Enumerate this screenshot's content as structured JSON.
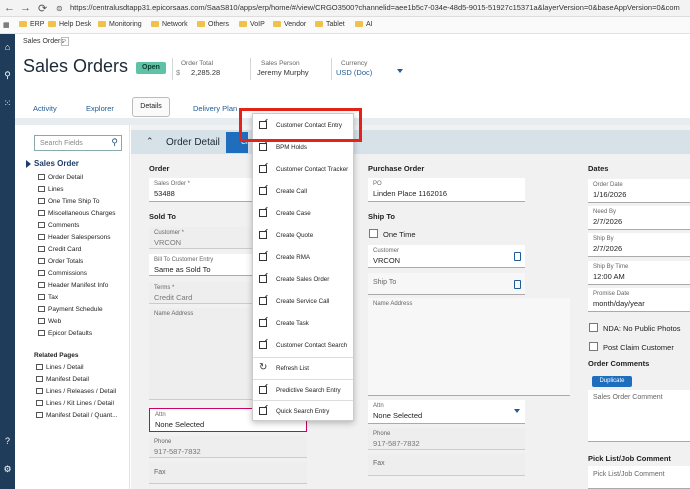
{
  "browser": {
    "url": "https://centralusdtapp31.epicorsaas.com/SaaS810/apps/erp/home/#/view/CRGO3500?channelid=aee1b5c7-034e-48d5-9015-51927c15371a&layerVersion=0&baseAppVersion=0&com",
    "bookmarks": [
      "ERP",
      "Help Desk",
      "Monitoring",
      "Network",
      "Others",
      "VoIP",
      "Vendor",
      "Tablet",
      "AI"
    ]
  },
  "header": {
    "breadcrumb": "Sales Orders",
    "title": "Sales Orders",
    "status": "Open",
    "order_total_label": "Order Total",
    "order_total_currency_symbol": "$",
    "order_total_value": "2,285.28",
    "sales_person_label": "Sales Person",
    "sales_person_value": "Jeremy Murphy",
    "currency_label": "Currency",
    "currency_value": "USD (Doc)"
  },
  "tabs": [
    "Activity",
    "Explorer",
    "Details",
    "Delivery Plan"
  ],
  "leftnav": {
    "search_placeholder": "Search Fields",
    "section": "Sales Order",
    "items": [
      "Order Detail",
      "Lines",
      "One Time Ship To",
      "Miscellaneous Charges",
      "Comments",
      "Header Salespersons",
      "Credit Card",
      "Order Totals",
      "Commissions",
      "Header Manifest Info",
      "Tax",
      "Payment Schedule",
      "Web",
      "Epicor Defaults"
    ],
    "related_header": "Related Pages",
    "related": [
      "Lines / Detail",
      "Manifest Detail",
      "Lines / Releases / Detail",
      "Lines / Kit Lines / Detail",
      "Manifest Detail / Quant..."
    ]
  },
  "detail": {
    "title": "Order Detail",
    "button_label": "Cre",
    "order_section": "Order",
    "sales_order_label": "Sales Order *",
    "sales_order_value": "53488",
    "sold_to_section": "Sold To",
    "customer_label": "Customer *",
    "customer_value": "VRCON",
    "bill_to_label": "Bill To Customer Entry",
    "bill_to_value": "Same as Sold To",
    "terms_label": "Terms *",
    "terms_value": "Credit Card",
    "name_address_label": "Name Address",
    "attn_label": "Attn",
    "attn_value": "None Selected",
    "phone_label": "Phone",
    "phone_value": "917-587-7832",
    "fax_label": "Fax",
    "po_section": "Purchase Order",
    "po_label": "PO",
    "po_value": "Linden Place 1162016",
    "ship_to_section": "Ship To",
    "one_time_label": "One Time",
    "ship_customer_label": "Customer",
    "ship_customer_value": "VRCON",
    "ship_to_label": "Ship To",
    "ship_name_address_label": "Name Address",
    "ship_attn_label": "Attn",
    "ship_attn_value": "None Selected",
    "ship_phone_label": "Phone",
    "ship_phone_value": "917-587-7832",
    "ship_fax_label": "Fax",
    "dates_section": "Dates",
    "order_date_label": "Order Date",
    "order_date_value": "1/16/2026",
    "need_by_label": "Need By",
    "need_by_value": "2/7/2026",
    "ship_by_label": "Ship By",
    "ship_by_value": "2/7/2026",
    "ship_by_time_label": "Ship By Time",
    "ship_by_time_value": "12:00 AM",
    "promise_date_label": "Promise Date",
    "promise_date_value": "month/day/year",
    "nda_label": "NDA: No Public Photos",
    "post_claim_label": "Post Claim Customer",
    "order_comments_section": "Order Comments",
    "duplicate_label": "Duplicate",
    "sales_order_comment_placeholder": "Sales Order Comment",
    "pick_list_section": "Pick List/Job Comment",
    "pick_list_placeholder": "Pick List/Job Comment"
  },
  "menu": {
    "items": [
      {
        "label": "Customer Contact Entry",
        "icon": "external-link-icon"
      },
      {
        "label": "BPM Holds",
        "icon": "external-link-icon"
      },
      {
        "label": "Customer Contact Tracker",
        "icon": "external-link-icon"
      },
      {
        "label": "Create Call",
        "icon": "external-link-icon"
      },
      {
        "label": "Create Case",
        "icon": "external-link-icon"
      },
      {
        "label": "Create Quote",
        "icon": "external-link-icon"
      },
      {
        "label": "Create RMA",
        "icon": "external-link-icon"
      },
      {
        "label": "Create Sales Order",
        "icon": "external-link-icon"
      },
      {
        "label": "Create Service Call",
        "icon": "external-link-icon"
      },
      {
        "label": "Create Task",
        "icon": "external-link-icon"
      },
      {
        "label": "Customer Contact Search",
        "icon": "external-link-icon"
      },
      {
        "label": "Refresh List",
        "icon": "refresh-icon"
      },
      {
        "label": "Predictive Search Entry",
        "icon": "external-link-icon"
      },
      {
        "label": "Quick Search Entry",
        "icon": "external-link-icon"
      }
    ]
  },
  "colors": {
    "accent": "#1f6dbd",
    "status": "#5fc1a6",
    "highlight": "#e2231a",
    "rail": "#1f3d5a"
  }
}
